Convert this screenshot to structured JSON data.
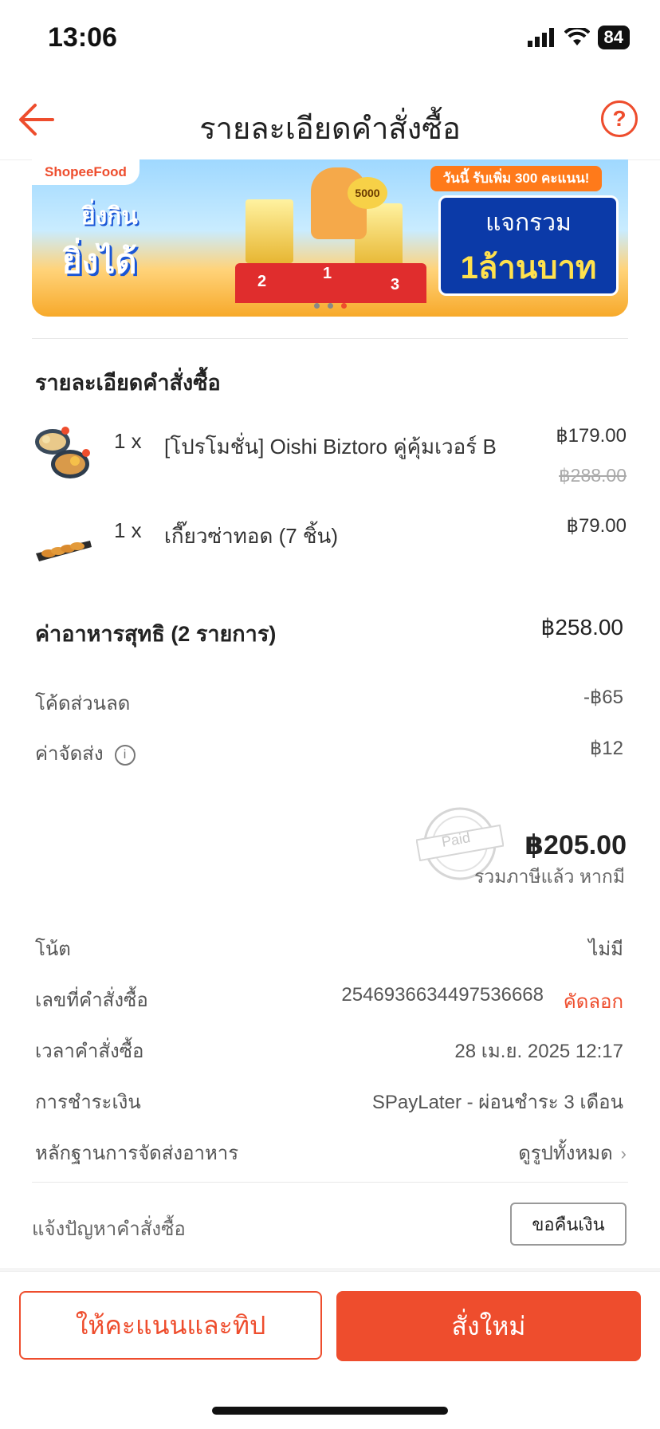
{
  "status_bar": {
    "time": "13:06",
    "battery": "84"
  },
  "header": {
    "title": "รายละเอียดคำสั่งซื้อ",
    "help_icon": "?"
  },
  "banner": {
    "brand": "ShopeeFood",
    "slogan_line1": "ยิ่งกิน",
    "slogan_line2": "ยิ่งได้",
    "podium_numbers": [
      "2",
      "1",
      "3"
    ],
    "coins_label": "5000",
    "promo_top": "วันนี้ รับเพิ่ม 300 คะแนน!",
    "promo_line1": "แจกรวม",
    "promo_line2": "1ล้านบาท",
    "carousel_pages": 3,
    "active_page": 3
  },
  "order": {
    "section_title": "รายละเอียดคำสั่งซื้อ",
    "items": [
      {
        "qty": "1 x",
        "name": "[โปรโมชั่น] Oishi Biztoro คู่คุ้มเวอร์ B",
        "price": "฿179.00",
        "original_price": "฿288.00"
      },
      {
        "qty": "1 x",
        "name": "เกี๊ยวซ่าทอด (7 ชิ้น)",
        "price": "฿79.00"
      }
    ],
    "subtotal_label": "ค่าอาหารสุทธิ (2 รายการ)",
    "subtotal_value": "฿258.00",
    "discount_label": "โค้ดส่วนลด",
    "discount_value": "-฿65",
    "delivery_label": "ค่าจัดส่ง",
    "delivery_value": "฿12",
    "paid_stamp": "Paid",
    "total_value": "฿205.00",
    "total_note": "รวมภาษีแล้ว หากมี"
  },
  "details": {
    "note_label": "โน้ต",
    "note_value": "ไม่มี",
    "order_no_label": "เลขที่คำสั่งซื้อ",
    "order_no_value": "2546936634497536668",
    "copy_label": "คัดลอก",
    "time_label": "เวลาคำสั่งซื้อ",
    "time_value": "28 เม.ย. 2025 12:17",
    "payment_label": "การชำระเงิน",
    "payment_value": "SPayLater - ผ่อนชำระ 3 เดือน",
    "proof_label": "หลักฐานการจัดส่งอาหาร",
    "proof_value": "ดูรูปทั้งหมด",
    "report_label": "แจ้งปัญหาคำสั่งซื้อ",
    "refund_label": "ขอคืนเงิน"
  },
  "footer": {
    "rate_label": "ให้คะแนนและทิป",
    "reorder_label": "สั่งใหม่"
  },
  "colors": {
    "accent": "#ee4d2d",
    "text": "#222222",
    "muted": "#555555"
  }
}
